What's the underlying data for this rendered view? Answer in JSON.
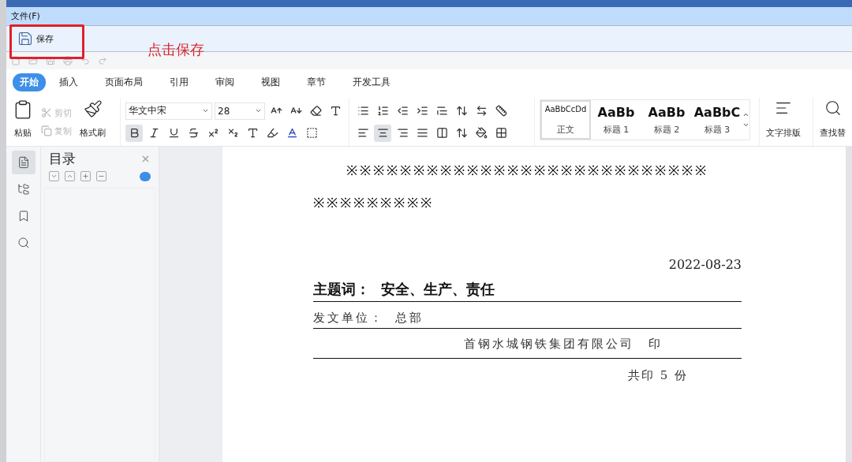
{
  "menu": [
    "文件(F)"
  ],
  "toolbar": {
    "save": "保存"
  },
  "annotation": {
    "text": "点击保存"
  },
  "ribbon_tabs": [
    {
      "label": "开始",
      "selected": true
    },
    {
      "label": "插入",
      "selected": false
    },
    {
      "label": "页面布局",
      "selected": false
    },
    {
      "label": "引用",
      "selected": false
    },
    {
      "label": "审阅",
      "selected": false
    },
    {
      "label": "视图",
      "selected": false
    },
    {
      "label": "章节",
      "selected": false
    },
    {
      "label": "开发工具",
      "selected": false
    }
  ],
  "clipboard": {
    "paste": "粘贴",
    "format_painter": "格式刷",
    "small": [
      {
        "kind": "cut",
        "label": "剪切",
        "disabled": true
      },
      {
        "kind": "copy",
        "label": "复制",
        "disabled": true
      }
    ]
  },
  "font": {
    "name": "华文中宋",
    "size": "28",
    "bold": {
      "selected": true
    }
  },
  "alignment": [
    {
      "kind": "left",
      "selected": false
    },
    {
      "kind": "center",
      "selected": true
    },
    {
      "kind": "right",
      "selected": false
    },
    {
      "kind": "justify",
      "selected": false
    },
    {
      "kind": "distributed",
      "selected": false
    }
  ],
  "styles": [
    {
      "preview": "AaBbCcDd",
      "label": "正文",
      "selected": true
    },
    {
      "preview": "AaBb",
      "label": "标题 1",
      "selected": false
    },
    {
      "preview": "AaBb",
      "label": "标题 2",
      "selected": false
    },
    {
      "preview": "AaBbC",
      "label": "标题 3",
      "selected": false
    }
  ],
  "text_layout": "文字排版",
  "find_replace": "查找替",
  "nav_panel": [
    {
      "kind": "toc",
      "selected": true
    },
    {
      "kind": "outline",
      "selected": false
    },
    {
      "kind": "bookmark",
      "selected": false
    },
    {
      "kind": "search",
      "selected": false
    }
  ],
  "toc": {
    "title": "目录"
  },
  "document": {
    "stars_1": "※※※※※※※※※※※※※※※※※※※※※※※※※※※",
    "stars_2": "※※※※※※※※※",
    "date": "2022-08-23",
    "subject_label": "主题词：",
    "subject": "安全、生产、责任",
    "issuer_label": "发文单位：",
    "issuer": "总部",
    "company": "首钢水城钢铁集团有限公司",
    "seal": "印",
    "copies": "共印 5 份"
  }
}
